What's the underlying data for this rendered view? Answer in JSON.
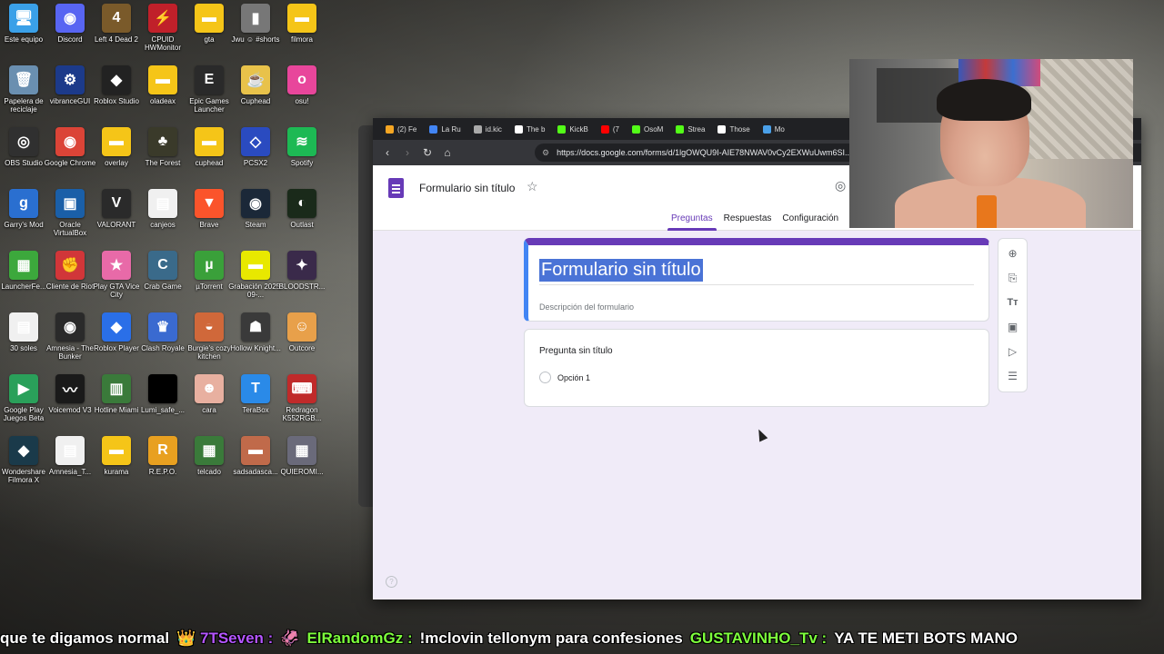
{
  "desktop": {
    "icons": [
      {
        "label": "Este equipo",
        "color": "#3aa0e8",
        "glyph": "🖥"
      },
      {
        "label": "Discord",
        "color": "#5865f2",
        "glyph": "◉"
      },
      {
        "label": "Left 4 Dead 2",
        "color": "#7a5a2a",
        "glyph": "4"
      },
      {
        "label": "CPUID HWMonitor",
        "color": "#c0202a",
        "glyph": "⚡"
      },
      {
        "label": "gta",
        "color": "#f5c518",
        "glyph": "▬"
      },
      {
        "label": "Jwu ☺ #shorts",
        "color": "#777777",
        "glyph": "▮"
      },
      {
        "label": "filmora",
        "color": "#f5c518",
        "glyph": "▬"
      },
      {
        "label": "Papelera de reciclaje",
        "color": "#6a8fb0",
        "glyph": "🗑"
      },
      {
        "label": "vibranceGUI",
        "color": "#1c3a8a",
        "glyph": "⚙"
      },
      {
        "label": "Roblox Studio",
        "color": "#222222",
        "glyph": "◆"
      },
      {
        "label": "oladeax",
        "color": "#f5c518",
        "glyph": "▬"
      },
      {
        "label": "Epic Games Launcher",
        "color": "#2a2a2a",
        "glyph": "E"
      },
      {
        "label": "Cuphead",
        "color": "#e8c24a",
        "glyph": "☕"
      },
      {
        "label": "osu!",
        "color": "#e8469b",
        "glyph": "o"
      },
      {
        "label": "OBS Studio",
        "color": "#303030",
        "glyph": "◎"
      },
      {
        "label": "Google Chrome",
        "color": "#db4437",
        "glyph": "◉"
      },
      {
        "label": "overlay",
        "color": "#f5c518",
        "glyph": "▬"
      },
      {
        "label": "The Forest",
        "color": "#3a3a2a",
        "glyph": "♣"
      },
      {
        "label": "cuphead",
        "color": "#f5c518",
        "glyph": "▬"
      },
      {
        "label": "PCSX2",
        "color": "#2a4bc0",
        "glyph": "◇"
      },
      {
        "label": "Spotify",
        "color": "#1db954",
        "glyph": "≋"
      },
      {
        "label": "Garry's Mod",
        "color": "#2a6fd0",
        "glyph": "g"
      },
      {
        "label": "Oracle VirtualBox",
        "color": "#1a5fa8",
        "glyph": "▣"
      },
      {
        "label": "VALORANT",
        "color": "#2a2a2a",
        "glyph": "V"
      },
      {
        "label": "canjeos",
        "color": "#f0f0f0",
        "glyph": "▤"
      },
      {
        "label": "Brave",
        "color": "#fb542b",
        "glyph": "▼"
      },
      {
        "label": "Steam",
        "color": "#1b2838",
        "glyph": "◉"
      },
      {
        "label": "Outlast",
        "color": "#1a2a1a",
        "glyph": "◐"
      },
      {
        "label": "LauncherFe...",
        "color": "#3ca83c",
        "glyph": "▦"
      },
      {
        "label": "Cliente de Riot",
        "color": "#d13639",
        "glyph": "✊"
      },
      {
        "label": "Play GTA Vice City",
        "color": "#e86aa8",
        "glyph": "★"
      },
      {
        "label": "Crab Game",
        "color": "#3a6a8a",
        "glyph": "C"
      },
      {
        "label": "µTorrent",
        "color": "#3aa03a",
        "glyph": "µ"
      },
      {
        "label": "Grabación 2025-09-...",
        "color": "#e8e800",
        "glyph": "▬"
      },
      {
        "label": "BLOODSTR...",
        "color": "#3a2a4a",
        "glyph": "✦"
      },
      {
        "label": "30 soles",
        "color": "#f0f0f0",
        "glyph": "▤"
      },
      {
        "label": "Amnesia - The Bunker",
        "color": "#2a2a2a",
        "glyph": "◉"
      },
      {
        "label": "Roblox Player",
        "color": "#2a6fe8",
        "glyph": "◆"
      },
      {
        "label": "Clash Royale",
        "color": "#3a6ad0",
        "glyph": "♛"
      },
      {
        "label": "Burgie's cozy kitchen",
        "color": "#d0683a",
        "glyph": "◒"
      },
      {
        "label": "Hollow Knight...",
        "color": "#3a3a3a",
        "glyph": "☗"
      },
      {
        "label": "Outcore",
        "color": "#e8a04a",
        "glyph": "☺"
      },
      {
        "label": "Google Play Juegos Beta",
        "color": "#2aa05a",
        "glyph": "▶"
      },
      {
        "label": "Voicemod V3",
        "color": "#1a1a1a",
        "glyph": "〰"
      },
      {
        "label": "Hotline Miami",
        "color": "#3a7a3a",
        "glyph": "▥"
      },
      {
        "label": "Lumi_safe_...",
        "color": "#000000",
        "glyph": " "
      },
      {
        "label": "cara",
        "color": "#e8b0a0",
        "glyph": "☻"
      },
      {
        "label": "TeraBox",
        "color": "#2a8ae8",
        "glyph": "T"
      },
      {
        "label": "Redragon K552RGB...",
        "color": "#c02a2a",
        "glyph": "⌨"
      },
      {
        "label": "Wondershare Filmora X",
        "color": "#1a3a4a",
        "glyph": "◆"
      },
      {
        "label": "Amnesia_T...",
        "color": "#f0f0f0",
        "glyph": "▤"
      },
      {
        "label": "kurama",
        "color": "#f5c518",
        "glyph": "▬"
      },
      {
        "label": "R.E.P.O.",
        "color": "#e8a020",
        "glyph": "R"
      },
      {
        "label": "telcado",
        "color": "#3a7a3a",
        "glyph": "▦"
      },
      {
        "label": "sadsadasca...",
        "color": "#c06a4a",
        "glyph": "▬"
      },
      {
        "label": "QUIEROMI...",
        "color": "#6a6a7a",
        "glyph": "▦"
      }
    ]
  },
  "browser": {
    "tabs": [
      {
        "label": "(2) Fe",
        "color": "#f5a623"
      },
      {
        "label": "La Ru",
        "color": "#4285f4"
      },
      {
        "label": "id.kic",
        "color": "#aaaaaa"
      },
      {
        "label": "The b",
        "color": "#ffffff"
      },
      {
        "label": "KickB",
        "color": "#53fc18"
      },
      {
        "label": "(7",
        "color": "#ff0000"
      },
      {
        "label": "OsoM",
        "color": "#53fc18"
      },
      {
        "label": "Strea",
        "color": "#53fc18"
      },
      {
        "label": "Those",
        "color": "#ffffff"
      },
      {
        "label": "Mo",
        "color": "#4aa0e8"
      }
    ],
    "url": "https://docs.google.com/forms/d/1lgOWQU9I-AIE78NWAV0vCy2EXWuUwm6SI...",
    "form": {
      "doc_title": "Formulario sin título",
      "tabs": [
        "Preguntas",
        "Respuestas",
        "Configuración"
      ],
      "active_tab": "Preguntas",
      "title": "Formulario sin título",
      "description_placeholder": "Descripción del formulario",
      "question_title": "Pregunta sin título",
      "option_label": "Opción 1",
      "accent_color": "#673ab7",
      "background_color": "#f0ebf8"
    },
    "toolbar_icons": [
      "add-question-icon",
      "import-questions-icon",
      "add-title-icon",
      "add-image-icon",
      "add-video-icon",
      "add-section-icon"
    ]
  },
  "chat_ticker": {
    "segments": [
      {
        "text": "que te digamos normal",
        "kind": "msg"
      },
      {
        "text": "👑 7TSeven :",
        "kind": "user-purple"
      },
      {
        "text": "🦑",
        "kind": "msg"
      },
      {
        "text": "ElRandomGz :",
        "kind": "user-green"
      },
      {
        "text": "!mclovin tellonym para confesiones",
        "kind": "msg"
      },
      {
        "text": "GUSTAVINHO_Tv :",
        "kind": "user-green"
      },
      {
        "text": "YA TE METI BOTS MANO",
        "kind": "msg"
      }
    ]
  }
}
